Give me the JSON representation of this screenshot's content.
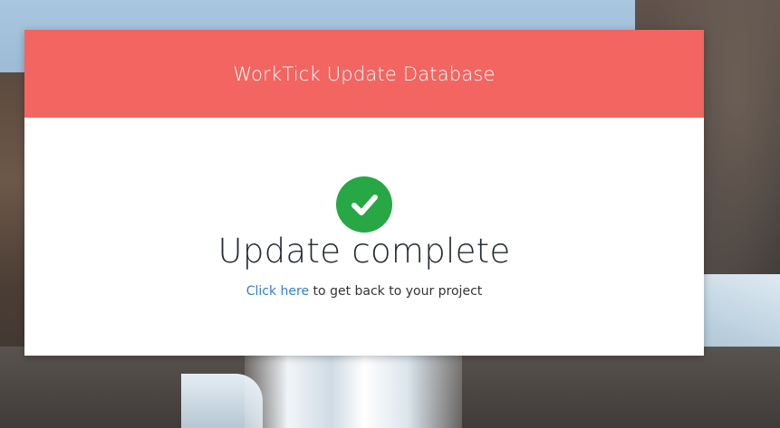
{
  "header": {
    "title": "WorkTick Update Database"
  },
  "status": {
    "icon": "check-circle-icon",
    "icon_color": "#28a745",
    "heading": "Update complete"
  },
  "back": {
    "link_text": "Click here",
    "trailing_text": " to get back to your project"
  },
  "colors": {
    "header_bg": "#f26560",
    "link": "#2f7fd4"
  }
}
